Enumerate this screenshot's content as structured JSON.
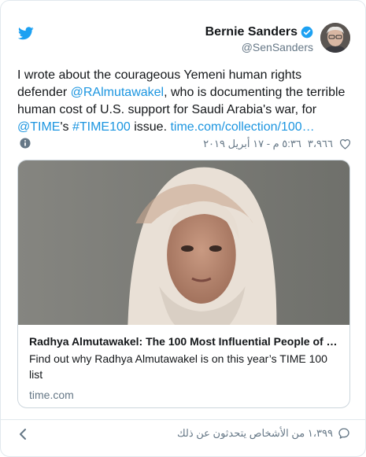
{
  "author": {
    "name": "Bernie Sanders",
    "handle": "@SenSanders",
    "verified": true
  },
  "tweet": {
    "parts": [
      "I wrote about the courageous Yemeni human rights defender ",
      "@RAlmutawakel",
      ", who is documenting the terrible human cost of U.S. support for Saudi Arabia's war, for ",
      "@TIME",
      "'s ",
      "#TIME100",
      " issue. ",
      "time.com/collection/100…"
    ]
  },
  "meta": {
    "likes": "٣،٩٦٦",
    "timestamp": "٥:٣٦ م - ١٧ أبريل ٢٠١٩"
  },
  "link_card": {
    "title": "Radhya Almutawakel: The 100 Most Influential People of …",
    "description": "Find out why Radhya Almutawakel is on this year’s TIME 100 list",
    "domain": "time.com"
  },
  "footer": {
    "conversation_text": "١،٣٩٩ من الأشخاص يتحدثون عن ذلك"
  },
  "colors": {
    "link": "#1b95e0",
    "secondary_text": "#657786",
    "verified_badge": "#1da1f2",
    "twitter_brand": "#1da1f2"
  },
  "icons": [
    "twitter-bird-icon",
    "verified-badge-icon",
    "info-icon",
    "heart-icon",
    "chevron-left-icon",
    "comment-icon"
  ]
}
